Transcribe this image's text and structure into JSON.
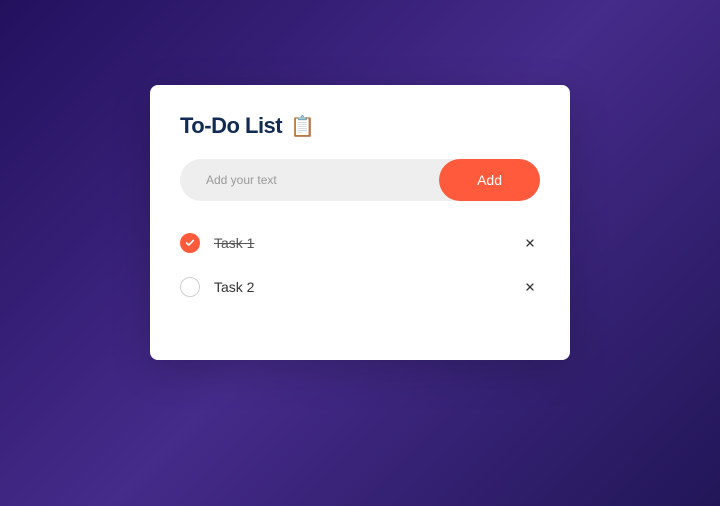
{
  "header": {
    "title": "To-Do List",
    "icon": "📋"
  },
  "input": {
    "placeholder": "Add your text",
    "value": ""
  },
  "add_button_label": "Add",
  "tasks": [
    {
      "label": "Task 1",
      "done": true
    },
    {
      "label": "Task 2",
      "done": false
    }
  ]
}
